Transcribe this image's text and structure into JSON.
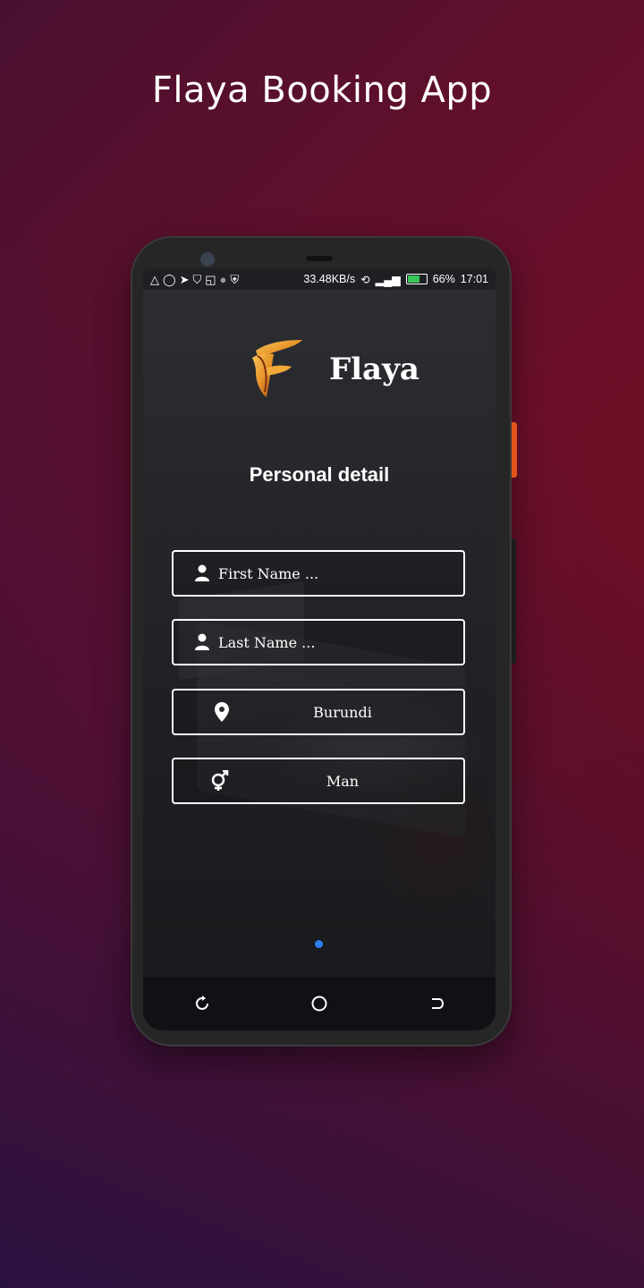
{
  "promo": {
    "title": "Flaya Booking App"
  },
  "status_bar": {
    "speed": "33.48KB/s",
    "battery_percent": "66%",
    "time": "17:01",
    "left_icons": [
      "warning-icon",
      "whatsapp-icon",
      "telegram-icon",
      "shirt-icon",
      "screen-icon",
      "circle-icon",
      "shield-icon"
    ],
    "right_icons": [
      "rotate-icon",
      "signal-icon",
      "battery-icon"
    ]
  },
  "app": {
    "brand": "Flaya",
    "section_title": "Personal detail",
    "fields": {
      "first_name": {
        "placeholder": "First Name ...",
        "icon": "user-icon"
      },
      "last_name": {
        "placeholder": "Last Name ...",
        "icon": "user-icon"
      },
      "country": {
        "value": "Burundi",
        "icon": "location-pin-icon"
      },
      "gender": {
        "value": "Man",
        "icon": "gender-icon"
      }
    },
    "pager": {
      "pages": 1,
      "active": 1,
      "active_color": "#2f7df2"
    }
  },
  "nav_bar": {
    "buttons": [
      "recent-apps",
      "home",
      "back"
    ]
  },
  "colors": {
    "accent": "#2f7df2",
    "field_border": "#ffffff",
    "logo_orange": "#e8962a"
  }
}
